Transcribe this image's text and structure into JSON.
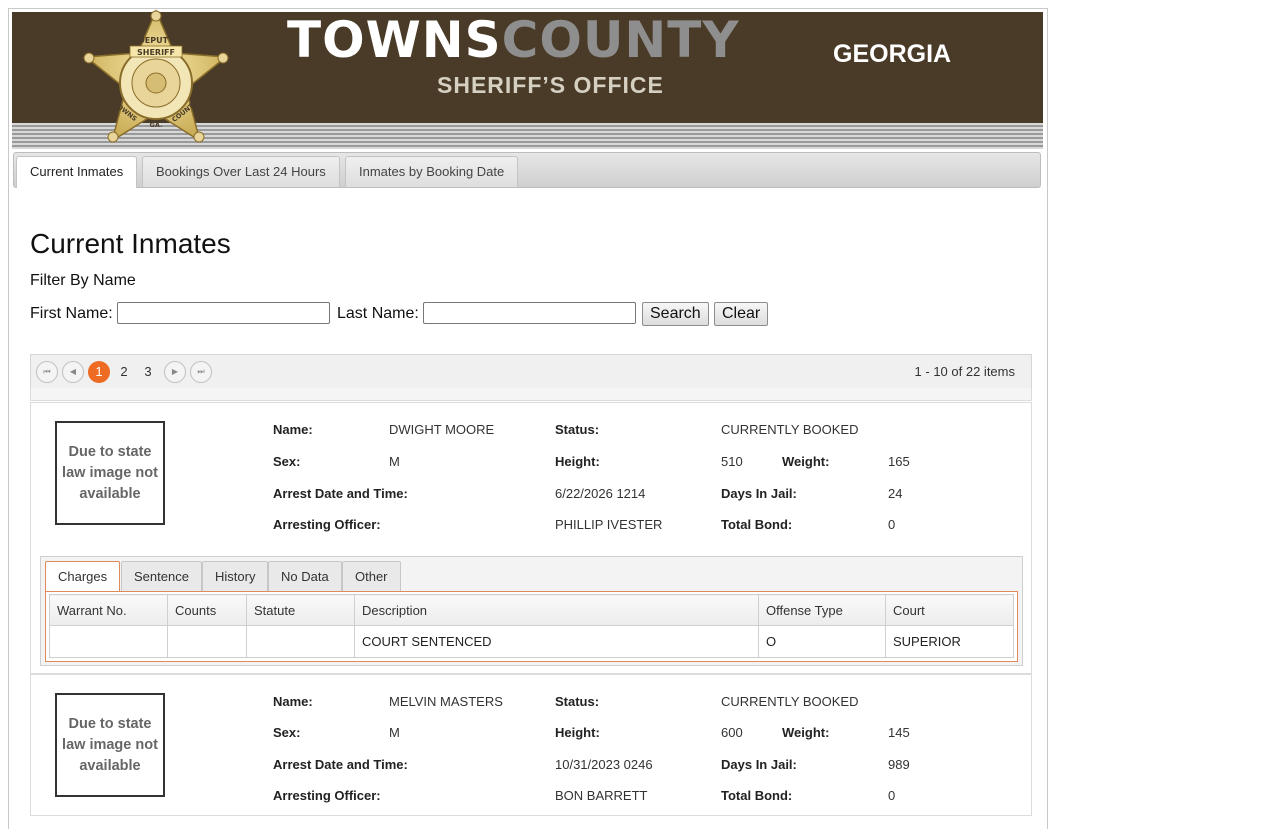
{
  "banner": {
    "title_part1": "TOWNS",
    "title_part2": "COUNTY",
    "state": "GEORGIA",
    "subtitle": "SHERIFF’S OFFICE",
    "badge_text": [
      "DEPUTY",
      "SHERIFF",
      "TOWNS",
      "GA.",
      "COUNTY"
    ]
  },
  "nav_tabs": [
    "Current Inmates",
    "Bookings Over Last 24 Hours",
    "Inmates by Booking Date"
  ],
  "page_title": "Current Inmates",
  "filter": {
    "heading": "Filter By Name",
    "first_label": "First Name:",
    "first_value": "",
    "last_label": "Last Name:",
    "last_value": "",
    "search_label": "Search",
    "clear_label": "Clear"
  },
  "pager": {
    "pages": [
      "1",
      "2",
      "3"
    ],
    "current_page": "1",
    "info": "1 - 10 of 22 items",
    "first_glyph": "⏮",
    "prev_glyph": "◀",
    "next_glyph": "▶",
    "last_glyph": "⏭"
  },
  "labels": {
    "name": "Name:",
    "status": "Status:",
    "sex": "Sex:",
    "height": "Height:",
    "weight": "Weight:",
    "arrest": "Arrest Date and Time:",
    "days": "Days In Jail:",
    "officer": "Arresting Officer:",
    "bond": "Total Bond:",
    "no_image": "Due to state law image not available"
  },
  "detail_tabs": [
    "Charges",
    "Sentence",
    "History",
    "No Data",
    "Other"
  ],
  "charge_columns": [
    "Warrant No.",
    "Counts",
    "Statute",
    "Description",
    "Offense Type",
    "Court"
  ],
  "inmates": [
    {
      "name": "DWIGHT MOORE",
      "status": "CURRENTLY BOOKED",
      "sex": "M",
      "height": "510",
      "weight": "165",
      "arrest": "6/22/2026 1214",
      "days": "24",
      "officer": "PHILLIP IVESTER",
      "bond": "0",
      "charges": [
        {
          "warrant": "",
          "counts": "",
          "statute": "",
          "description": "COURT SENTENCED",
          "offense_type": "O",
          "court": "SUPERIOR"
        }
      ]
    },
    {
      "name": "MELVIN MASTERS",
      "status": "CURRENTLY BOOKED",
      "sex": "M",
      "height": "600",
      "weight": "145",
      "arrest": "10/31/2023 0246",
      "days": "989",
      "officer": "BON BARRETT",
      "bond": "0"
    }
  ],
  "colors": {
    "banner": "#4a3b28",
    "accent": "#ed6b22",
    "badge_gold": "#d9c27a"
  }
}
